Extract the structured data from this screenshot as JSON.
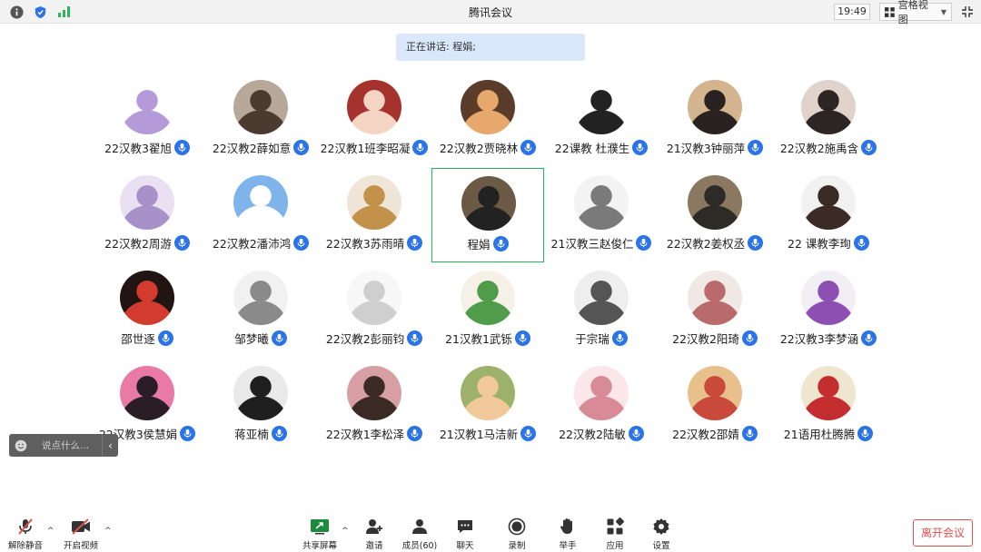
{
  "window": {
    "title": "腾讯会议",
    "clock": "19:49",
    "view_mode": "宫格视图"
  },
  "speaking_banner": "正在讲话: 程娟;",
  "participants": [
    {
      "name": "22汉教3翟旭",
      "avatar": "purple-cat-cartoon"
    },
    {
      "name": "22汉教2薛如意",
      "avatar": "portrait-photo"
    },
    {
      "name": "22汉教1班李昭凝",
      "avatar": "red-anime-girl"
    },
    {
      "name": "22汉教2贾晓林",
      "avatar": "anime-girl"
    },
    {
      "name": "22课教 杜濮生",
      "avatar": "line-drawing-man"
    },
    {
      "name": "21汉教3钟丽萍",
      "avatar": "smiling-girl"
    },
    {
      "name": "22汉教2施禹含",
      "avatar": "girl-photo"
    },
    {
      "name": "22汉教2周游",
      "avatar": "anime-white-hair"
    },
    {
      "name": "22汉教2潘沛鸿",
      "avatar": "blue-sky"
    },
    {
      "name": "22汉教3苏雨晴",
      "avatar": "dog-in-hat"
    },
    {
      "name": "程娟",
      "avatar": "woman-bookshelf"
    },
    {
      "name": "21汉教三赵俊仁",
      "avatar": "sketch"
    },
    {
      "name": "22汉教2姜权丞",
      "avatar": "young-man"
    },
    {
      "name": "22 课教李珣",
      "avatar": "girl-smiling"
    },
    {
      "name": "邵世逐",
      "avatar": "man-red"
    },
    {
      "name": "邹梦曦",
      "avatar": "statue"
    },
    {
      "name": "22汉教2彭丽钧",
      "avatar": "white-rabbit"
    },
    {
      "name": "21汉教1武铄",
      "avatar": "cartoon-cabbage"
    },
    {
      "name": "于宗瑞",
      "avatar": "minimal-figures"
    },
    {
      "name": "22汉教2阳琦",
      "avatar": "ink-girl"
    },
    {
      "name": "22汉教3李梦涵",
      "avatar": "anime-hat-girl"
    },
    {
      "name": "22汉教3侯慧娟",
      "avatar": "pink-card"
    },
    {
      "name": "蒋亚楠",
      "avatar": "dark-hand"
    },
    {
      "name": "22汉教1李松泽",
      "avatar": "girl-flowers"
    },
    {
      "name": "21汉教1马洁新",
      "avatar": "anime-boy"
    },
    {
      "name": "22汉教2陆敏",
      "avatar": "pink-bunny-girl"
    },
    {
      "name": "22汉教2邵婧",
      "avatar": "cake-fox"
    },
    {
      "name": "21语用杜腾腾",
      "avatar": "red-flower"
    }
  ],
  "active_speaker_index": 10,
  "chat": {
    "placeholder": "说点什么..."
  },
  "toolbar": {
    "unmute": "解除静音",
    "video": "开启视频",
    "share": "共享屏幕",
    "invite": "邀请",
    "members": "成员(60)",
    "chat": "聊天",
    "record": "录制",
    "raise_hand": "举手",
    "apps": "应用",
    "settings": "设置",
    "leave": "离开会议"
  },
  "colors": {
    "mic_blue": "#2a73e8",
    "active_border": "#22b35e",
    "leave_red": "#e24f4f",
    "banner_bg": "#dbe8fb"
  }
}
